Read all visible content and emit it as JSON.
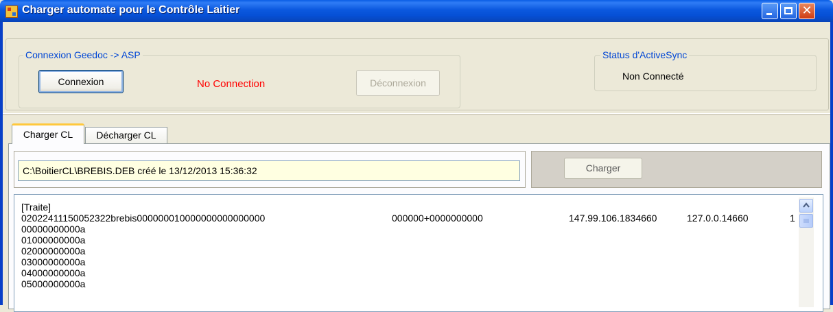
{
  "window": {
    "title": "Charger automate pour le Contrôle Laitier",
    "icon": "app-icon",
    "controls": [
      "minimize-icon",
      "maximize-icon",
      "close-icon"
    ]
  },
  "connection_group": {
    "legend": "Connexion Geedoc -> ASP",
    "connect_label": "Connexion",
    "status": "No Connection",
    "disconnect_label": "Déconnexion",
    "status_color": "#ff0000"
  },
  "activesync_group": {
    "legend": "Status d'ActiveSync",
    "status": "Non Connecté"
  },
  "tabs": [
    {
      "label": "Charger CL",
      "active": true
    },
    {
      "label": "Décharger CL",
      "active": false
    }
  ],
  "charger_tab": {
    "file_path": "C:\\BoitierCL\\BREBIS.DEB créé le 13/12/2013 15:36:32",
    "charger_label": "Charger",
    "log_lines": [
      "[Traite]",
      "02022411150052322brebis000000010000000000000000",
      "00000000000a",
      "01000000000a",
      "02000000000a",
      "03000000000a",
      "04000000000a",
      "05000000000a"
    ],
    "log_columns": [
      "000000+0000000000",
      "147.99.106.1834660",
      "127.0.0.14660",
      "1"
    ]
  },
  "colors": {
    "titlebar": "#0b58df",
    "legend": "#0046d5",
    "path_field_bg": "#ffffe1",
    "active_tab_accent": "#ffc83c"
  }
}
